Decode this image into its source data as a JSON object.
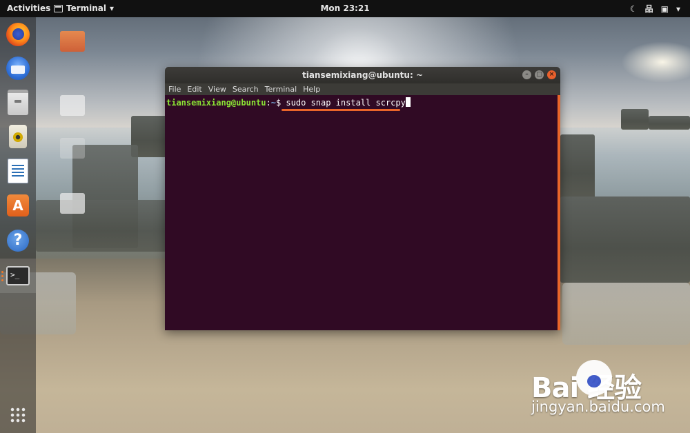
{
  "topbar": {
    "activities": "Activities",
    "app_name": "Terminal",
    "app_menu_arrow": "▾",
    "clock": "Mon 23:21",
    "tray_icons": [
      "night-light-icon",
      "network-icon",
      "battery-icon"
    ],
    "tray_arrow": "▾"
  },
  "dock": {
    "items": [
      {
        "name": "firefox"
      },
      {
        "name": "thunderbird"
      },
      {
        "name": "files"
      },
      {
        "name": "rhythmbox"
      },
      {
        "name": "libreoffice-writer"
      },
      {
        "name": "ubuntu-software"
      },
      {
        "name": "help"
      },
      {
        "name": "terminal"
      }
    ],
    "software_glyph": "A",
    "help_glyph": "?",
    "terminal_glyph": ">_"
  },
  "terminal": {
    "title": "tiansemixiang@ubuntu: ~",
    "menu": [
      "File",
      "Edit",
      "View",
      "Search",
      "Terminal",
      "Help"
    ],
    "prompt_user": "tiansemixiang@ubuntu",
    "prompt_sep": ":",
    "prompt_path": "~",
    "prompt_symbol": "$ ",
    "command": "sudo snap install scrcpy",
    "window_buttons": {
      "minimize": "–",
      "maximize": "□",
      "close": "×"
    }
  },
  "watermark": {
    "logo_text": "Bai  经验",
    "sub_text": "jingyan.baidu.com"
  },
  "colors": {
    "terminal_bg": "#300a24",
    "prompt_user": "#8ae234",
    "prompt_path": "#729fcf",
    "accent_orange": "#e9652a"
  }
}
